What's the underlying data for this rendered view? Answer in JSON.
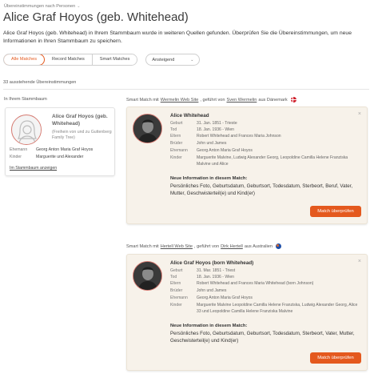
{
  "breadcrumb": {
    "label": "Übereinstimmungen nach Personen"
  },
  "page": {
    "title": "Alice Graf Hoyos (geb. Whitehead)",
    "intro": "Alice Graf Hoyos (geb. Whitehead) in Ihrem Stammbaum wurde in weiteren Quellen gefunden. Überprüfen Sie die Übereinstimmungen, um neue Informationen in Ihren Stammbaum zu speichern."
  },
  "tabs": [
    "Alle Matches",
    "Record Matches",
    "Smart Matches"
  ],
  "sort": {
    "label": "Ansteigend"
  },
  "count_text": "33 ausstehende Übereinstimmungen",
  "tree": {
    "heading": "In Ihrem Stammbaum",
    "name": "Alice Graf Hoyos (geb. Whitehead)",
    "note": "(Freihein von und zu Guttenberg Family Tree)",
    "rows": [
      {
        "label": "Ehemann",
        "value": "Georg Anton Maria Graf Hoyos"
      },
      {
        "label": "Kinder",
        "value": "Marguerite und Alexander"
      }
    ],
    "link": "Im Stammbaum anzeigen"
  },
  "matches": [
    {
      "head_prefix": "Smart Match mit",
      "site": "Wermelin Web Site",
      "head_mid": ", geführt von",
      "manager": "Sven Wermelin",
      "head_suffix": "aus Dänemark",
      "flag": "denmark-flag",
      "name": "Alice Whitehead",
      "rows": [
        {
          "label": "Geburt",
          "value": "31. Jan. 1851 - Trieste"
        },
        {
          "label": "Tod",
          "value": "18. Jan. 1936 - Wien"
        },
        {
          "label": "Eltern",
          "value": "Robert Whitehead and Frances Maria Johnson"
        },
        {
          "label": "Brüder",
          "value": "John und James"
        },
        {
          "label": "Ehemann",
          "value": "Georg Anton Maria Graf Hoyos"
        },
        {
          "label": "Kinder",
          "value": "Marguerite Malvine, Ludwig Alexander Georg, Leopoldine Camilla Helene Franziska Malvine und Alice"
        }
      ],
      "new_title": "Neue Information in diesem Match:",
      "new_text": "Persönliches Foto, Geburtsdatum, Geburtsort, Todesdatum, Sterbeort, Beruf, Vater, Mutter, Geschwisterteil(e) und Kind(er)",
      "button": "Match überprüfen"
    },
    {
      "head_prefix": "Smart Match mit",
      "site": "Hertell Web Site",
      "head_mid": ", geführt von",
      "manager": "Dirk Hertell",
      "head_suffix": "aus Australien",
      "flag": "australia-flag",
      "name": "Alice Graf Hoyos (born Whitehead)",
      "rows": [
        {
          "label": "Geburt",
          "value": "31. Mar. 1851 - Triest"
        },
        {
          "label": "Tod",
          "value": "18. Jan. 1936 - Wien"
        },
        {
          "label": "Eltern",
          "value": "Robert Whitehead and Frances Maria Whitehead (born Johnson)"
        },
        {
          "label": "Brüder",
          "value": "John und James"
        },
        {
          "label": "Ehemann",
          "value": "Georg Anton Maria Graf Hoyos"
        },
        {
          "label": "Kinder",
          "value": "Marguerite Malvine Leopoldine Camilla Helene Franziska, Ludwig Alexander Georg, Alice 33 und Leopoldine Camilla Helene Franziska Malvine"
        }
      ],
      "new_title": "Neue Information in diesem Match:",
      "new_text": "Persönliches Foto, Geburtsdatum, Geburtsort, Todesdatum, Sterbeort, Vater, Mutter, Geschwisterteil(e) und Kind(er)",
      "button": "Match überprüfen"
    }
  ],
  "colors": {
    "accent": "#e4591e",
    "card_bg": "#f7f2ea",
    "photo_border": "#d67b72"
  }
}
